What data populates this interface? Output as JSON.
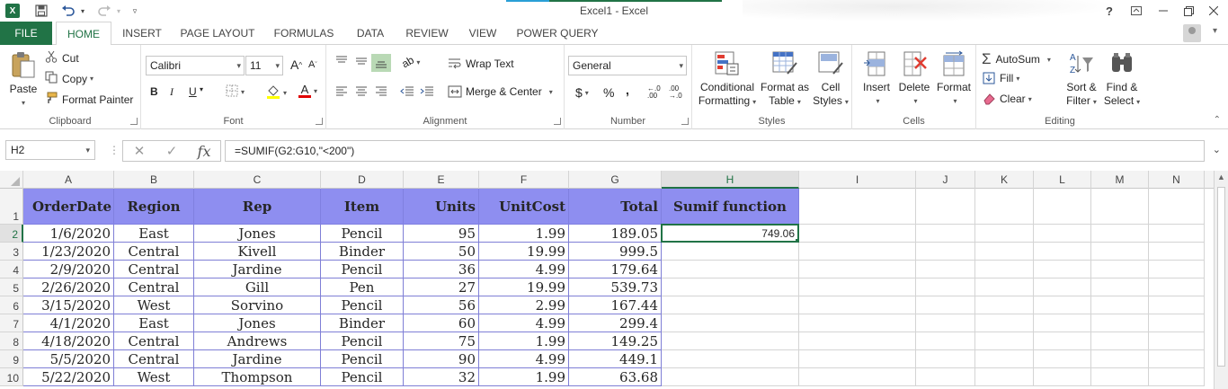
{
  "title_bar": {
    "app_icon": "X",
    "document_title": "Excel1 - Excel",
    "help": "?",
    "quick_access": [
      "save-icon",
      "undo-icon",
      "redo-icon",
      "customize-icon"
    ],
    "window_buttons": [
      "ribbon-display-icon",
      "minimize-icon",
      "restore-icon",
      "close-icon"
    ]
  },
  "tabs": {
    "file": "FILE",
    "home": "HOME",
    "insert": "INSERT",
    "page_layout": "PAGE LAYOUT",
    "formulas": "FORMULAS",
    "data": "DATA",
    "review": "REVIEW",
    "view": "VIEW",
    "power_query": "POWER QUERY"
  },
  "ribbon": {
    "clipboard": {
      "label": "Clipboard",
      "paste": "Paste",
      "cut": "Cut",
      "copy": "Copy",
      "format_painter": "Format Painter"
    },
    "font": {
      "label": "Font",
      "family": "Calibri",
      "size": "11",
      "bold": "B",
      "italic": "I",
      "underline": "U",
      "grow": "A",
      "shrink": "A",
      "font_color_letter": "A"
    },
    "alignment": {
      "label": "Alignment",
      "wrap_text": "Wrap Text",
      "merge_center": "Merge & Center"
    },
    "number": {
      "label": "Number",
      "format": "General",
      "currency": "$",
      "percent": "%",
      "comma": ",",
      "inc_decimal": "←.0 .00",
      "dec_decimal": ".00 →.0"
    },
    "styles": {
      "label": "Styles",
      "conditional_1": "Conditional",
      "conditional_2": "Formatting",
      "format_as_1": "Format as",
      "format_as_2": "Table",
      "cell_styles_1": "Cell",
      "cell_styles_2": "Styles"
    },
    "cells": {
      "label": "Cells",
      "insert": "Insert",
      "delete": "Delete",
      "format": "Format"
    },
    "editing": {
      "label": "Editing",
      "autosum": "AutoSum",
      "fill": "Fill",
      "clear": "Clear",
      "sort_1": "Sort &",
      "sort_2": "Filter",
      "find_1": "Find &",
      "find_2": "Select"
    }
  },
  "formula_bar": {
    "name_box": "H2",
    "formula": "=SUMIF(G2:G10,\"<200\")",
    "fx": "fx"
  },
  "sheet": {
    "columns": [
      "A",
      "B",
      "C",
      "D",
      "E",
      "F",
      "G",
      "H",
      "I",
      "J",
      "K",
      "L",
      "M",
      "N"
    ],
    "rows": [
      "1",
      "2",
      "3",
      "4",
      "5",
      "6",
      "7",
      "8",
      "9",
      "10"
    ],
    "headers": [
      "OrderDate",
      "Region",
      "Rep",
      "Item",
      "Units",
      "UnitCost",
      "Total",
      "Sumif function"
    ],
    "data": [
      [
        "1/6/2020",
        "East",
        "Jones",
        "Pencil",
        "95",
        "1.99",
        "189.05"
      ],
      [
        "1/23/2020",
        "Central",
        "Kivell",
        "Binder",
        "50",
        "19.99",
        "999.5"
      ],
      [
        "2/9/2020",
        "Central",
        "Jardine",
        "Pencil",
        "36",
        "4.99",
        "179.64"
      ],
      [
        "2/26/2020",
        "Central",
        "Gill",
        "Pen",
        "27",
        "19.99",
        "539.73"
      ],
      [
        "3/15/2020",
        "West",
        "Sorvino",
        "Pencil",
        "56",
        "2.99",
        "167.44"
      ],
      [
        "4/1/2020",
        "East",
        "Jones",
        "Binder",
        "60",
        "4.99",
        "299.4"
      ],
      [
        "4/18/2020",
        "Central",
        "Andrews",
        "Pencil",
        "75",
        "1.99",
        "149.25"
      ],
      [
        "5/5/2020",
        "Central",
        "Jardine",
        "Pencil",
        "90",
        "4.99",
        "449.1"
      ],
      [
        "5/22/2020",
        "West",
        "Thompson",
        "Pencil",
        "32",
        "1.99",
        "63.68"
      ]
    ],
    "active_cell_value": "749.06",
    "header_fill": "#8e8ef0",
    "accent": "#217346"
  }
}
